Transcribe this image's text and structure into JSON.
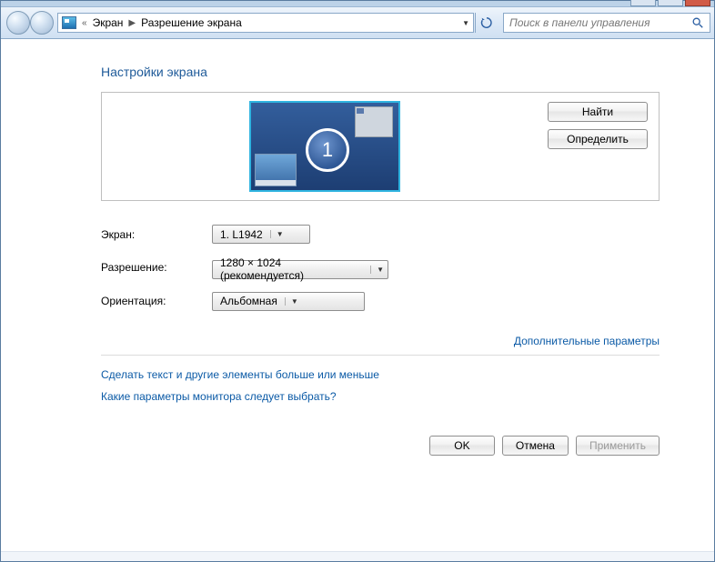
{
  "breadcrumb": {
    "prefix": "«",
    "part1": "Экран",
    "part2": "Разрешение экрана"
  },
  "search": {
    "placeholder": "Поиск в панели управления"
  },
  "page_title": "Настройки экрана",
  "monitor_badge": "1",
  "buttons": {
    "detect": "Найти",
    "identify": "Определить",
    "ok": "OK",
    "cancel": "Отмена",
    "apply": "Применить"
  },
  "form": {
    "display_label": "Экран:",
    "display_value": "1. L1942",
    "resolution_label": "Разрешение:",
    "resolution_value": "1280 × 1024 (рекомендуется)",
    "orientation_label": "Ориентация:",
    "orientation_value": "Альбомная"
  },
  "links": {
    "advanced": "Дополнительные параметры",
    "text_size": "Сделать текст и другие элементы больше или меньше",
    "which_monitor": "Какие параметры монитора следует выбрать?"
  }
}
